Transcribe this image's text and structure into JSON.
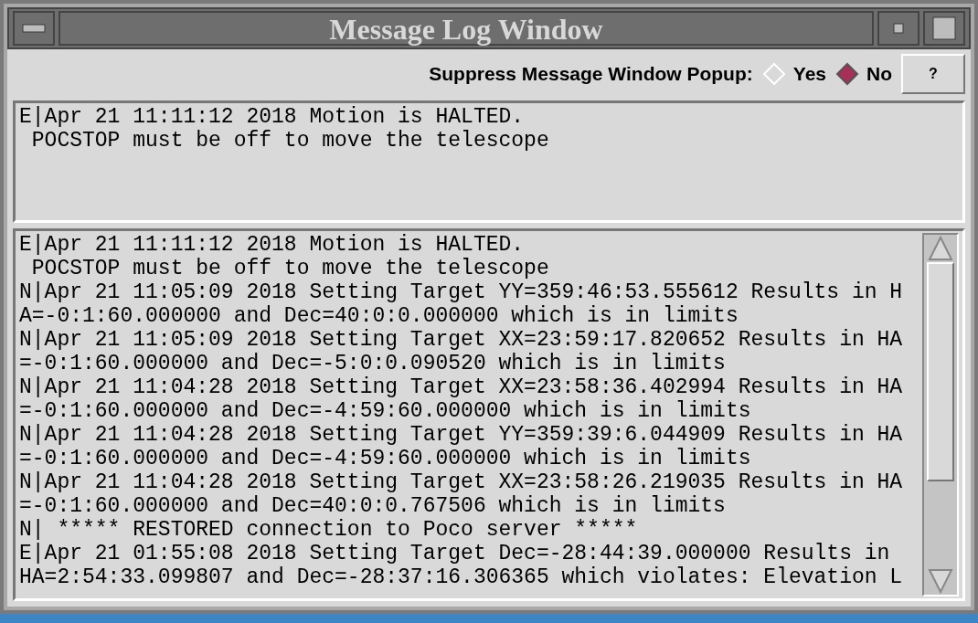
{
  "window": {
    "title": "Message Log Window"
  },
  "popup_setting": {
    "label": "Suppress Message Window Popup:",
    "options": [
      {
        "label": "Yes",
        "selected": false
      },
      {
        "label": "No",
        "selected": true
      }
    ],
    "help_button": "?"
  },
  "current_message": {
    "lines": [
      "E|Apr 21 11:11:12 2018 Motion is HALTED.",
      " POCSTOP must be off to move the telescope"
    ]
  },
  "log": {
    "lines": [
      "E|Apr 21 11:11:12 2018 Motion is HALTED.",
      " POCSTOP must be off to move the telescope",
      "N|Apr 21 11:05:09 2018 Setting Target YY=359:46:53.555612 Results in H",
      "A=-0:1:60.000000 and Dec=40:0:0.000000 which is in limits",
      "N|Apr 21 11:05:09 2018 Setting Target XX=23:59:17.820652 Results in HA",
      "=-0:1:60.000000 and Dec=-5:0:0.090520 which is in limits",
      "N|Apr 21 11:04:28 2018 Setting Target XX=23:58:36.402994 Results in HA",
      "=-0:1:60.000000 and Dec=-4:59:60.000000 which is in limits",
      "N|Apr 21 11:04:28 2018 Setting Target YY=359:39:6.044909 Results in HA",
      "=-0:1:60.000000 and Dec=-4:59:60.000000 which is in limits",
      "N|Apr 21 11:04:28 2018 Setting Target XX=23:58:26.219035 Results in HA",
      "=-0:1:60.000000 and Dec=40:0:0.767506 which is in limits",
      "N| ***** RESTORED connection to Poco server *****",
      "E|Apr 21 01:55:08 2018 Setting Target Dec=-28:44:39.000000 Results in ",
      "HA=2:54:33.099807 and Dec=-28:37:16.306365 which violates: Elevation L"
    ]
  }
}
